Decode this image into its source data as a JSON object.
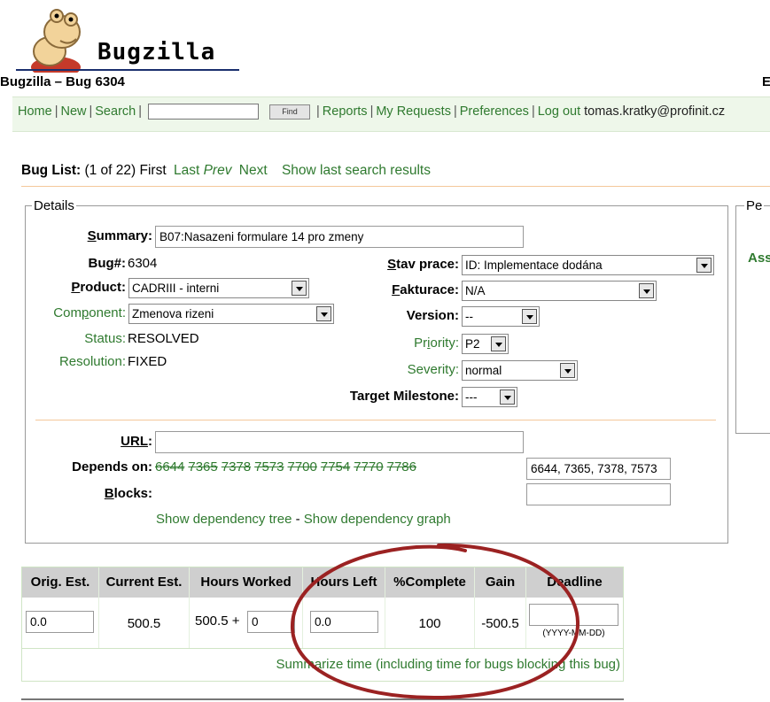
{
  "header": {
    "logo_text": "Bugzilla",
    "page_title": "Bugzilla – Bug 6304",
    "title_right_char": "E"
  },
  "nav": {
    "home": "Home",
    "new": "New",
    "search": "Search",
    "search_value": "",
    "find_button": "Find",
    "reports": "Reports",
    "my_requests": "My Requests",
    "preferences": "Preferences",
    "logout": "Log out",
    "user_email": "tomas.kratky@profinit.cz"
  },
  "buglist": {
    "label": "Bug List:",
    "count": "(1 of 22)",
    "first": "First",
    "last": "Last",
    "prev": "Prev",
    "next": "Next",
    "show_last": "Show last search results"
  },
  "details": {
    "legend": "Details",
    "summary_label": "Summary",
    "summary_value": "B07:Nasazeni formulare 14 pro zmeny",
    "bug_label": "Bug#",
    "bug_value": "6304",
    "product_label": "Product",
    "product_value": "CADRIII - interni",
    "component_label": "Component",
    "component_value": "Zmenova rizeni",
    "status_label": "Status:",
    "status_value": "RESOLVED",
    "resolution_label": "Resolution:",
    "resolution_value": "FIXED",
    "stav_label": "Stav prace",
    "stav_value": "ID: Implementace dodána",
    "fakturace_label": "Fakturace",
    "fakturace_value": "N/A",
    "version_label": "Version",
    "version_value": "--",
    "priority_label": "Priority",
    "priority_value": "P2",
    "severity_label": "Severity",
    "severity_value": "normal",
    "milestone_label": "Target Milestone",
    "milestone_value": "---",
    "url_label": "URL",
    "url_value": "",
    "depends_label": "Depends on:",
    "depends_list": [
      "6644",
      "7365",
      "7378",
      "7573",
      "7700",
      "7754",
      "7770",
      "7786"
    ],
    "depends_input": "6644, 7365, 7378, 7573",
    "blocks_label": "Blocks:",
    "blocks_value": "",
    "dep_tree": "Show dependency tree",
    "dep_sep": "-",
    "dep_graph": "Show dependency graph"
  },
  "side": {
    "legend": "Pe",
    "ass": "Ass"
  },
  "time": {
    "headers": [
      "Orig. Est.",
      "Current Est.",
      "Hours Worked",
      "Hours Left",
      "%Complete",
      "Gain",
      "Deadline"
    ],
    "orig_est": "0.0",
    "current_est": "500.5",
    "hours_worked": "500.5 +",
    "hours_worked_add": "0",
    "hours_left": "0.0",
    "complete": "100",
    "gain": "-500.5",
    "deadline": "",
    "deadline_hint": "(YYYY-MM-DD)",
    "summarize": "Summarize time (including time for bugs blocking this bug)"
  },
  "colors": {
    "link_green": "#2f7a2f",
    "nav_bg": "#eef7ea",
    "annotation_red": "#9b2222"
  }
}
